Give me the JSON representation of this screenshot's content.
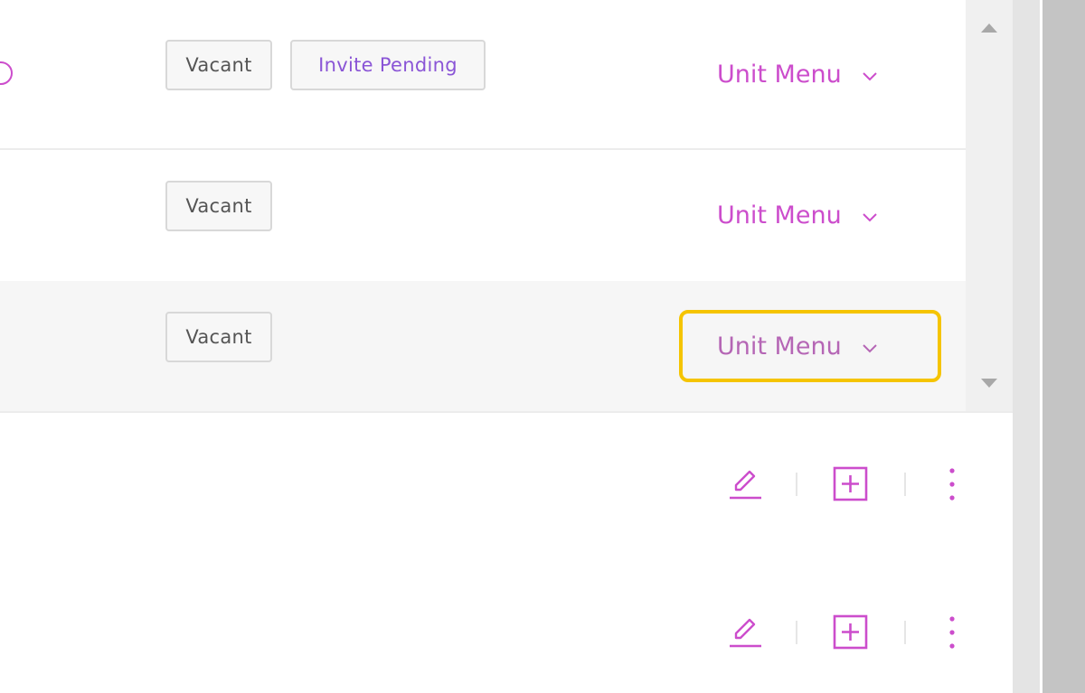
{
  "colors": {
    "accent": "#cc4dcc",
    "invite_text": "#8a55d6",
    "highlight": "#f5c400"
  },
  "units": [
    {
      "tags": [
        "Vacant",
        "Invite Pending"
      ],
      "menu_label": "Unit Menu"
    },
    {
      "tags": [
        "Vacant"
      ],
      "menu_label": "Unit Menu"
    },
    {
      "tags": [
        "Vacant"
      ],
      "menu_label": "Unit Menu",
      "highlighted": true
    }
  ],
  "row_actions": [
    {
      "icons": [
        "edit-icon",
        "add-box-icon",
        "more-vertical-icon"
      ]
    },
    {
      "icons": [
        "edit-icon",
        "add-box-icon",
        "more-vertical-icon"
      ]
    }
  ]
}
